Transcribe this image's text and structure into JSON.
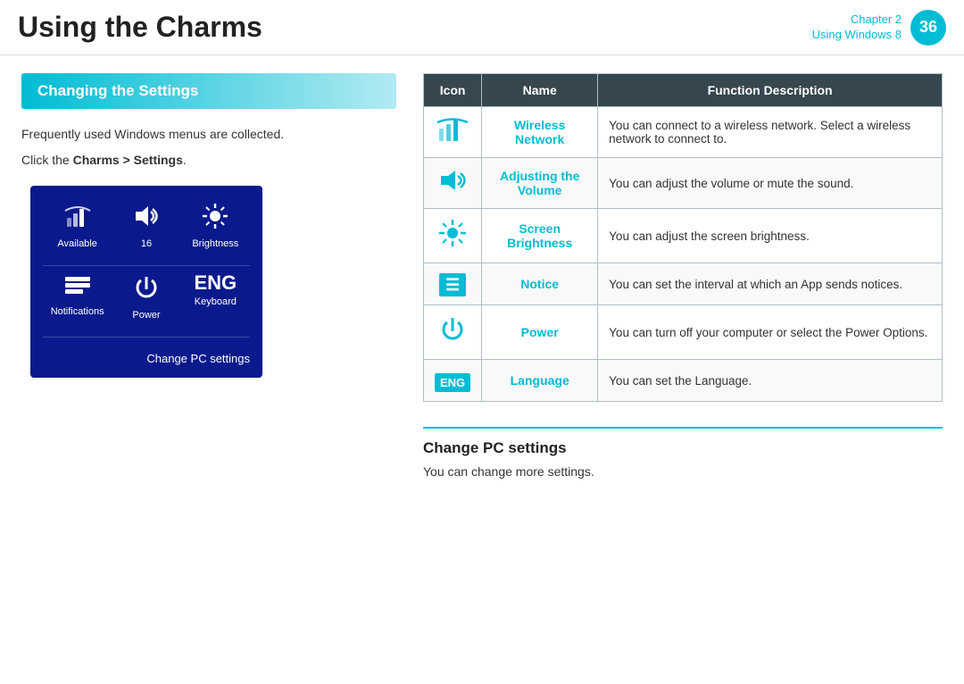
{
  "header": {
    "title": "Using the Charms",
    "chapter_label": "Chapter 2",
    "chapter_sublabel": "Using Windows 8",
    "page_number": "36"
  },
  "left": {
    "section_heading": "Changing the Settings",
    "desc1": "Frequently used Windows menus are collected.",
    "desc2_prefix": "Click the ",
    "desc2_bold": "Charms > Settings",
    "desc2_suffix": ".",
    "panel": {
      "row1": [
        {
          "label": "Available",
          "icon_type": "wifi"
        },
        {
          "label": "16",
          "icon_type": "volume"
        },
        {
          "label": "Brightness",
          "icon_type": "brightness"
        }
      ],
      "row2": [
        {
          "label": "Notifications",
          "icon_type": "notifications"
        },
        {
          "label": "Power",
          "icon_type": "power"
        },
        {
          "label": "Keyboard",
          "icon_type": "eng"
        }
      ],
      "change_pc": "Change PC settings"
    }
  },
  "table": {
    "headers": [
      "Icon",
      "Name",
      "Function Description"
    ],
    "rows": [
      {
        "icon_type": "wifi",
        "name": "Wireless\nNetwork",
        "description": "You can connect to a wireless network. Select a wireless network to connect to."
      },
      {
        "icon_type": "volume",
        "name": "Adjusting the\nVolume",
        "description": "You can adjust the volume or mute the sound."
      },
      {
        "icon_type": "brightness",
        "name": "Screen\nBrightness",
        "description": "You can adjust the screen brightness."
      },
      {
        "icon_type": "notice",
        "name": "Notice",
        "description": "You can set the interval at which an App sends notices."
      },
      {
        "icon_type": "power",
        "name": "Power",
        "description": "You can turn off your computer or select the Power Options."
      },
      {
        "icon_type": "eng",
        "name": "Language",
        "description": "You can set the Language."
      }
    ]
  },
  "change_pc_section": {
    "title": "Change PC settings",
    "description": "You can change more settings."
  }
}
